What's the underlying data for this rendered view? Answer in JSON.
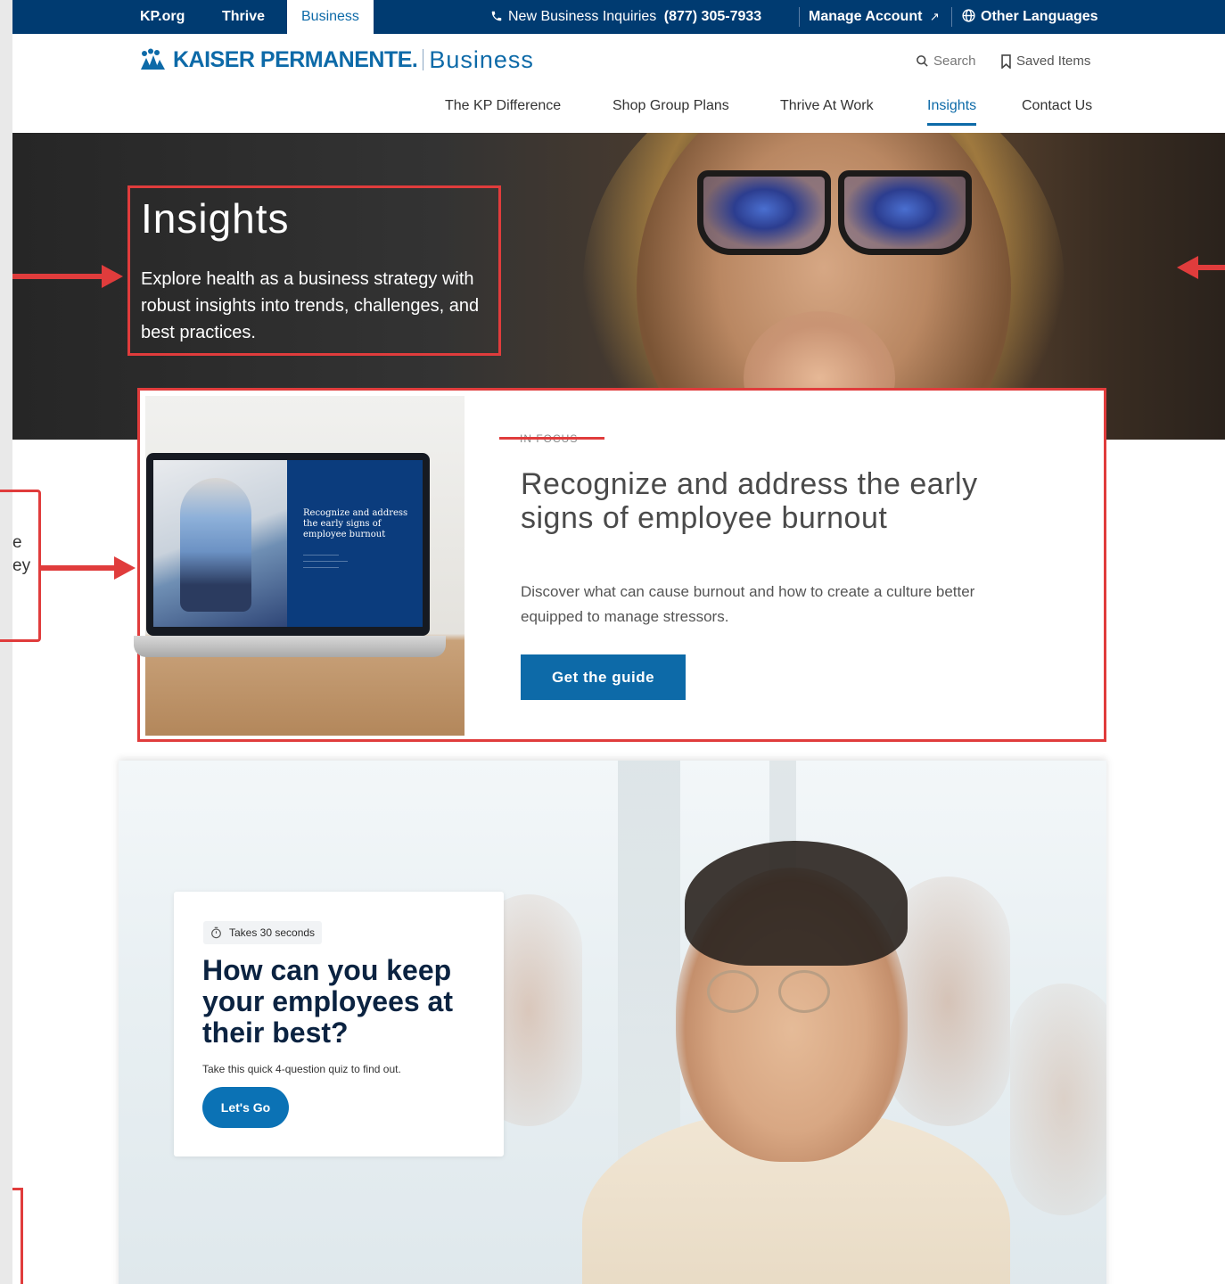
{
  "topbar": {
    "tabs": [
      "KP.org",
      "Thrive",
      "Business"
    ],
    "inquiry_label": "New Business Inquiries",
    "inquiry_phone": "(877) 305-7933",
    "manage_account": "Manage Account",
    "other_languages": "Other Languages"
  },
  "header": {
    "logo_text": "KAISER PERMANENTE.",
    "logo_business": "Business",
    "search_label": "Search",
    "saved_items_label": "Saved Items"
  },
  "nav": {
    "items": [
      "The KP Difference",
      "Shop Group Plans",
      "Thrive At Work",
      "Insights",
      "Contact Us"
    ],
    "active": "Insights"
  },
  "hero": {
    "title": "Insights",
    "subtitle": "Explore health as a business strategy with robust insights into trends, challenges, and best practices."
  },
  "focus": {
    "eyebrow": "IN FOCUS",
    "title": "Recognize and address the early signs of employee burnout",
    "description": "Discover what can cause burnout and how to create a culture better equipped to manage stressors.",
    "button_label": "Get the guide",
    "laptop_title": "Recognize and address the early signs of employee burnout"
  },
  "side_annotation": {
    "line1": "e",
    "line2": "ey"
  },
  "quiz": {
    "badge": "Takes 30 seconds",
    "title": "How can you keep your employees at their best?",
    "subtitle": "Take this quick 4-question quiz to find out.",
    "button_label": "Let's Go"
  },
  "colors": {
    "topbar_bg": "#003b71",
    "brand_blue": "#0d6aa8",
    "annotation_red": "#e03c3c",
    "quiz_title": "#0b2341"
  }
}
